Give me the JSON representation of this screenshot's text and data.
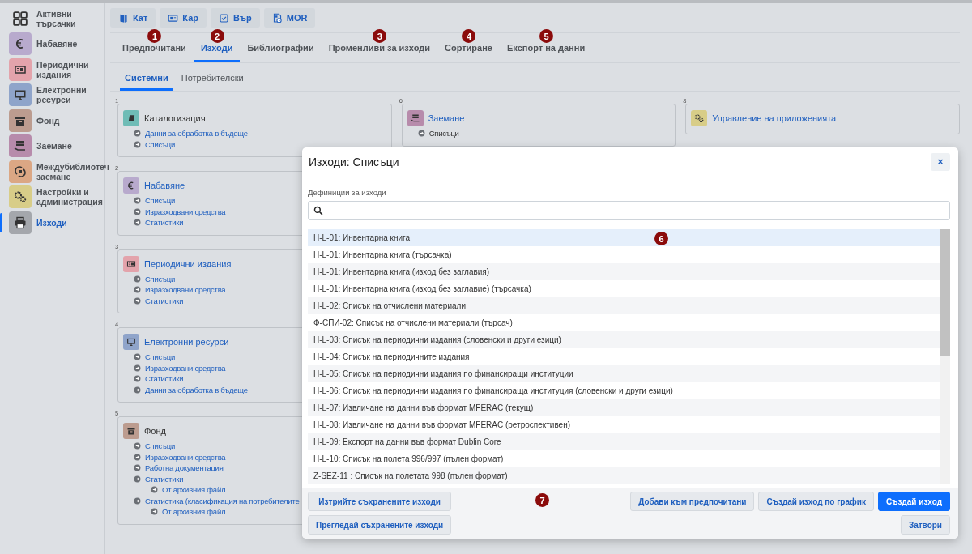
{
  "toolbar": [
    {
      "label": "Кат"
    },
    {
      "label": "Кар"
    },
    {
      "label": "Вър"
    },
    {
      "label": "MOR"
    }
  ],
  "sidebar": {
    "items": [
      {
        "label": "Активни търсачки",
        "selected": false
      },
      {
        "label": "Набавяне",
        "color": "#b8aacd",
        "selected": false
      },
      {
        "label": "Периодични издания",
        "color": "#e3a3ab",
        "selected": false
      },
      {
        "label": "Електронни ресурси",
        "color": "#8fa4ca",
        "selected": false
      },
      {
        "label": "Фонд",
        "color": "#bc9c8f",
        "selected": false
      },
      {
        "label": "Заемане",
        "color": "#b78bab",
        "selected": false
      },
      {
        "label": "Междубиблиотеч заемане",
        "color": "#dba784",
        "selected": false
      },
      {
        "label": "Настройки и администрация",
        "color": "#d8cd88",
        "selected": false
      },
      {
        "label": "Изходи",
        "color": "#a4a7ac",
        "selected": true
      }
    ]
  },
  "tabs": [
    {
      "label": "Предпочитани",
      "selected": false,
      "marker": "1"
    },
    {
      "label": "Изходи",
      "selected": true,
      "marker": "2"
    },
    {
      "label": "Библиографии",
      "selected": false
    },
    {
      "label": "Променливи за изходи",
      "selected": false,
      "marker": "3"
    },
    {
      "label": "Сортиране",
      "selected": false,
      "marker": "4"
    },
    {
      "label": "Експорт на данни",
      "selected": false,
      "marker": "5"
    }
  ],
  "subtabs": [
    {
      "label": "Системни",
      "selected": true
    },
    {
      "label": "Потребителски",
      "selected": false
    }
  ],
  "columns": [
    {
      "cards": [
        {
          "number": "1",
          "title": "Каталогизация",
          "link": false,
          "color": "#6fbcb6",
          "items": [
            {
              "label": "Данни за обработка в бъдеще",
              "link": true
            },
            {
              "label": "Списъци",
              "link": true
            }
          ]
        },
        {
          "number": "2",
          "title": "Набавяне",
          "link": true,
          "color": "#b8aacd",
          "items": [
            {
              "label": "Списъци",
              "link": true
            },
            {
              "label": "Изразходвани средства",
              "link": true
            },
            {
              "label": "Статистики",
              "link": true
            }
          ]
        },
        {
          "number": "3",
          "title": "Периодични издания",
          "link": true,
          "color": "#e3a3ab",
          "items": [
            {
              "label": "Списъци",
              "link": true
            },
            {
              "label": "Изразходвани средства",
              "link": true
            },
            {
              "label": "Статистики",
              "link": true
            }
          ]
        },
        {
          "number": "4",
          "title": "Електронни ресурси",
          "link": true,
          "color": "#8fa4ca",
          "items": [
            {
              "label": "Списъци",
              "link": true
            },
            {
              "label": "Изразходвани средства",
              "link": true
            },
            {
              "label": "Статистики",
              "link": true
            },
            {
              "label": "Данни за обработка в бъдеще",
              "link": true
            }
          ]
        },
        {
          "number": "5",
          "title": "Фонд",
          "link": false,
          "color": "#bc9c8f",
          "items": [
            {
              "label": "Списъци",
              "link": true
            },
            {
              "label": "Изразходвани средства",
              "link": true
            },
            {
              "label": "Работна документация",
              "link": true
            },
            {
              "label": "Статистики",
              "link": true,
              "children": [
                {
                  "label": "От архивния файл",
                  "link": true
                }
              ]
            },
            {
              "label": "Статистика (класификация на потребителите",
              "link": true,
              "children": [
                {
                  "label": "От архивния файл",
                  "link": true
                }
              ]
            }
          ]
        }
      ]
    },
    {
      "cards": [
        {
          "number": "6",
          "title": "Заемане",
          "link": true,
          "color": "#b78bab",
          "items": [
            {
              "label": "Списъци",
              "link": false
            }
          ]
        }
      ]
    },
    {
      "cards": [
        {
          "number": "8",
          "title": "Управление на приложенията",
          "link": true,
          "color": "#d8cd88"
        }
      ]
    }
  ],
  "modal": {
    "title": "Изходи: Списъци",
    "close": "×",
    "field_label": "Дефиниции за изходи",
    "list_marker": "6",
    "rows": [
      {
        "label": "H-L-01: Инвентарна книга",
        "selected": true
      },
      {
        "label": "H-L-01: Инвентарна книга (търсачка)",
        "selected": false
      },
      {
        "label": "H-L-01: Инвентарна книга (изход без заглавия)",
        "selected": false
      },
      {
        "label": "H-L-01: Инвентарна книга (изход без заглавие) (търсачка)",
        "selected": false
      },
      {
        "label": "H-L-02: Списък на отчислени материали",
        "selected": false
      },
      {
        "label": "Ф-СПИ-02: Списък на отчислени материали (търсач)",
        "selected": false
      },
      {
        "label": "H-L-03: Списък на периодични издания (словенски и други езици)",
        "selected": false
      },
      {
        "label": "H-L-04: Списък на периодичните издания",
        "selected": false
      },
      {
        "label": "H-L-05: Списък на периодични издания по финансиращи институции",
        "selected": false
      },
      {
        "label": "H-L-06: Списък на периодични издания по финансираща институция (словенски и други езици)",
        "selected": false
      },
      {
        "label": "H-L-07: Извличане на данни във формат MFERAC (текущ)",
        "selected": false
      },
      {
        "label": "H-L-08: Извличане на данни във формат MFERAC (ретроспективен)",
        "selected": false
      },
      {
        "label": "H-L-09: Експорт на данни във формат Dublin Core",
        "selected": false
      },
      {
        "label": "H-L-10: Списък на полета 996/997 (пълен формат)",
        "selected": false
      },
      {
        "label": "Z-SEZ-11 : Списък на полетата 998 (пълен формат)",
        "selected": false
      }
    ],
    "footer_marker": "7",
    "left_buttons": [
      {
        "label": "Изтрийте съхранените изходи"
      },
      {
        "label": "Прегледай съхранените изходи"
      }
    ],
    "right_buttons": [
      {
        "label": "Добави към предпочитани",
        "primary": false
      },
      {
        "label": "Създай изход по график",
        "primary": false
      },
      {
        "label": "Създай изход",
        "primary": true
      }
    ],
    "close_button": "Затвори"
  }
}
